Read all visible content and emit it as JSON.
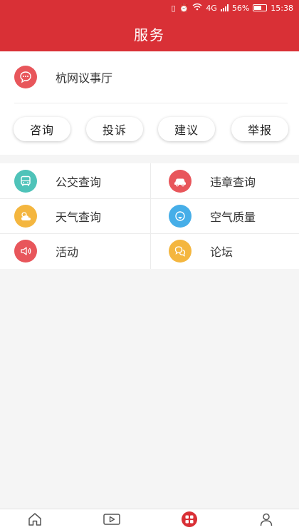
{
  "status_bar": {
    "network": "4G",
    "battery": "56%",
    "time": "15:38"
  },
  "header": {
    "title": "服务"
  },
  "hall": {
    "label": "杭网议事厅",
    "buttons": [
      "咨询",
      "投诉",
      "建议",
      "举报"
    ]
  },
  "services": [
    {
      "label": "公交查询",
      "icon": "bus-icon",
      "color": "#4fc3b9"
    },
    {
      "label": "违章查询",
      "icon": "car-icon",
      "color": "#e8565b"
    },
    {
      "label": "天气查询",
      "icon": "weather-icon",
      "color": "#f4b63f"
    },
    {
      "label": "空气质量",
      "icon": "air-quality-icon",
      "color": "#46aee8"
    },
    {
      "label": "活动",
      "icon": "megaphone-icon",
      "color": "#e8565b"
    },
    {
      "label": "论坛",
      "icon": "chat-bubbles-icon",
      "color": "#f4b63f"
    }
  ],
  "tabbar": {
    "active_color": "#d93036",
    "items": [
      "home-icon",
      "video-icon",
      "service-grid-icon",
      "user-icon"
    ]
  }
}
